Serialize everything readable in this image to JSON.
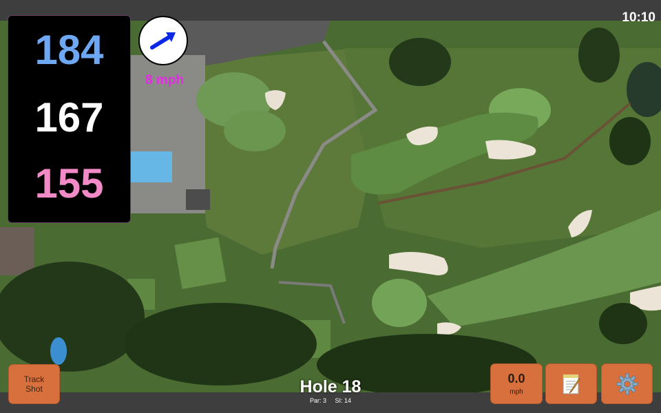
{
  "clock": "10:10",
  "distances": {
    "back": "184",
    "middle": "167",
    "front": "155",
    "colors": {
      "back": "#6ea7f2",
      "middle": "#ffffff",
      "front": "#f28ac8"
    }
  },
  "wind": {
    "speed_label": "8 mph",
    "arrow_icon": "wind-direction-arrow",
    "label_color": "#e22ee2"
  },
  "buttons": {
    "track_shot": "Track Shot",
    "speed_value": "0.0",
    "speed_unit": "mph",
    "notes_icon": "notepad-icon",
    "settings_icon": "gear-icon",
    "accent": "#d8703e"
  },
  "hole": {
    "title": "Hole 18",
    "par": "Par: 3",
    "stroke_index": "SI: 14"
  }
}
